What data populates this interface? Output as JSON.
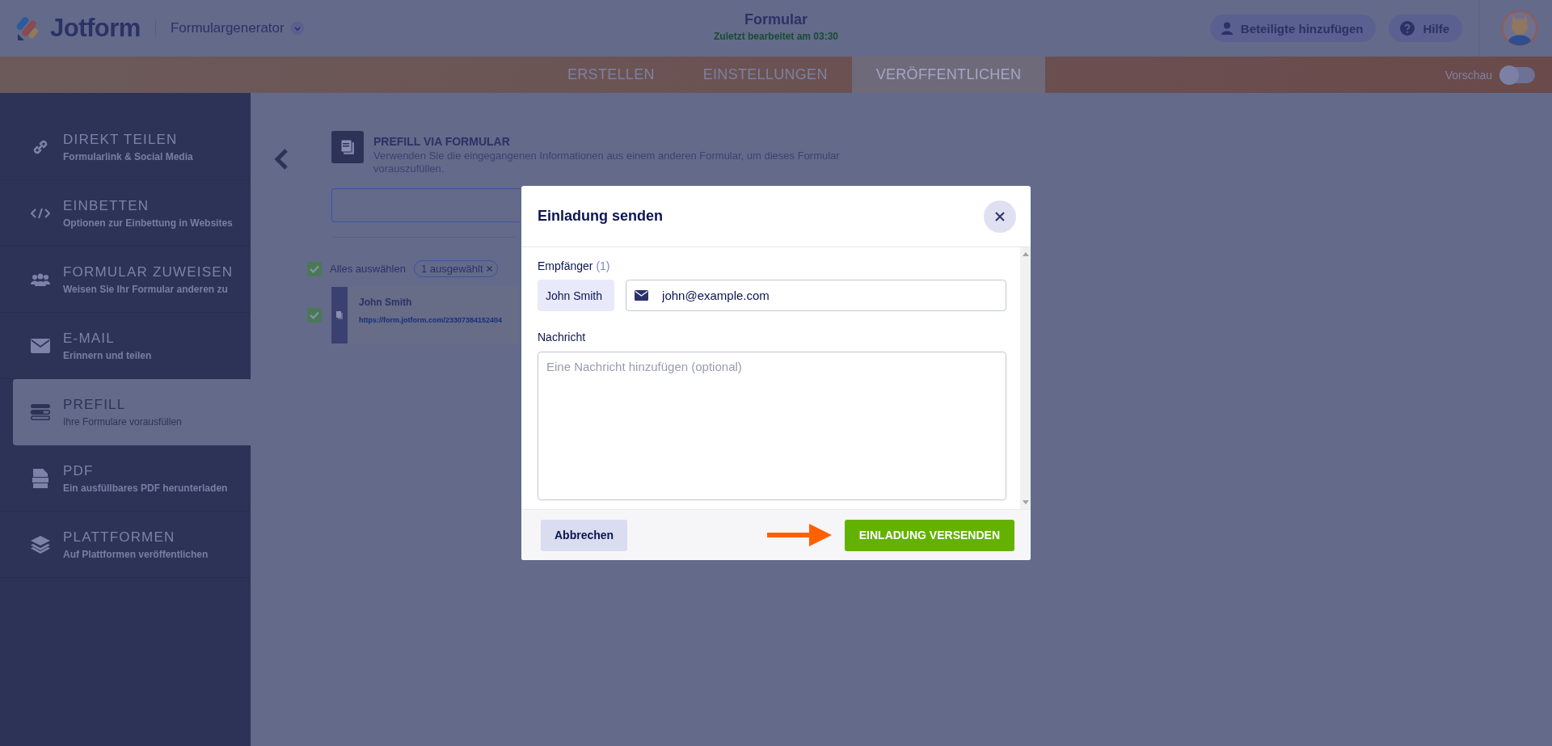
{
  "header": {
    "logo": "Jotform",
    "product": "Formulargenerator",
    "title": "Formular",
    "subtitle": "Zuletzt bearbeitet am 03:30",
    "buttons": [
      {
        "label": "Beteiligte hinzufügen",
        "kind": "person"
      },
      {
        "label": "Hilfe",
        "kind": "help"
      }
    ]
  },
  "tabs": [
    {
      "label": "ERSTELLEN",
      "selected": false
    },
    {
      "label": "EINSTELLUNGEN",
      "selected": false
    },
    {
      "label": "VERÖFFENTLICHEN",
      "selected": true
    }
  ],
  "preview": {
    "label": "Vorschau",
    "on": false
  },
  "sidebar": {
    "items": [
      {
        "title": "DIREKT TEILEN",
        "subtitle": "Formularlink & Social Media",
        "selected": false
      },
      {
        "title": "EINBETTEN",
        "subtitle": "Optionen zur Einbettung in Websites",
        "selected": false
      },
      {
        "title": "FORMULAR ZUWEISEN",
        "subtitle": "Weisen Sie Ihr Formular anderen zu",
        "selected": false
      },
      {
        "title": "E-MAIL",
        "subtitle": "Erinnern und teilen",
        "selected": false
      },
      {
        "title": "PREFILL",
        "subtitle": "Ihre Formulare vorausfüllen",
        "selected": true
      },
      {
        "title": "PDF",
        "subtitle": "Ein ausfüllbares PDF herunterladen",
        "selected": false
      },
      {
        "title": "PLATTFORMEN",
        "subtitle": "Auf Plattformen veröffentlichen",
        "selected": false
      }
    ]
  },
  "prefill": {
    "title": "PREFILL VIA FORMULAR",
    "description": "Verwenden Sie die eingegangenen Informationen aus einem anderen Formular, um dieses Formular vorauszufüllen.",
    "select_all": {
      "label": "Alles auswählen",
      "checked": true
    },
    "selected_badge": "1 ausgewählt",
    "rows": [
      {
        "name": "John Smith",
        "link": "https://form.jotform.com/23307384152404",
        "checked": true
      }
    ]
  },
  "dialog": {
    "title": "Einladung senden",
    "recipients_label": "Empfänger",
    "recipients_count": "(1)",
    "recipient_name": "John Smith",
    "email": "john@example.com",
    "message_label": "Nachricht",
    "message_placeholder": "Eine Nachricht hinzufügen (optional)",
    "cancel": "Abbrechen",
    "submit": "EINLADUNG VERSENDEN"
  }
}
